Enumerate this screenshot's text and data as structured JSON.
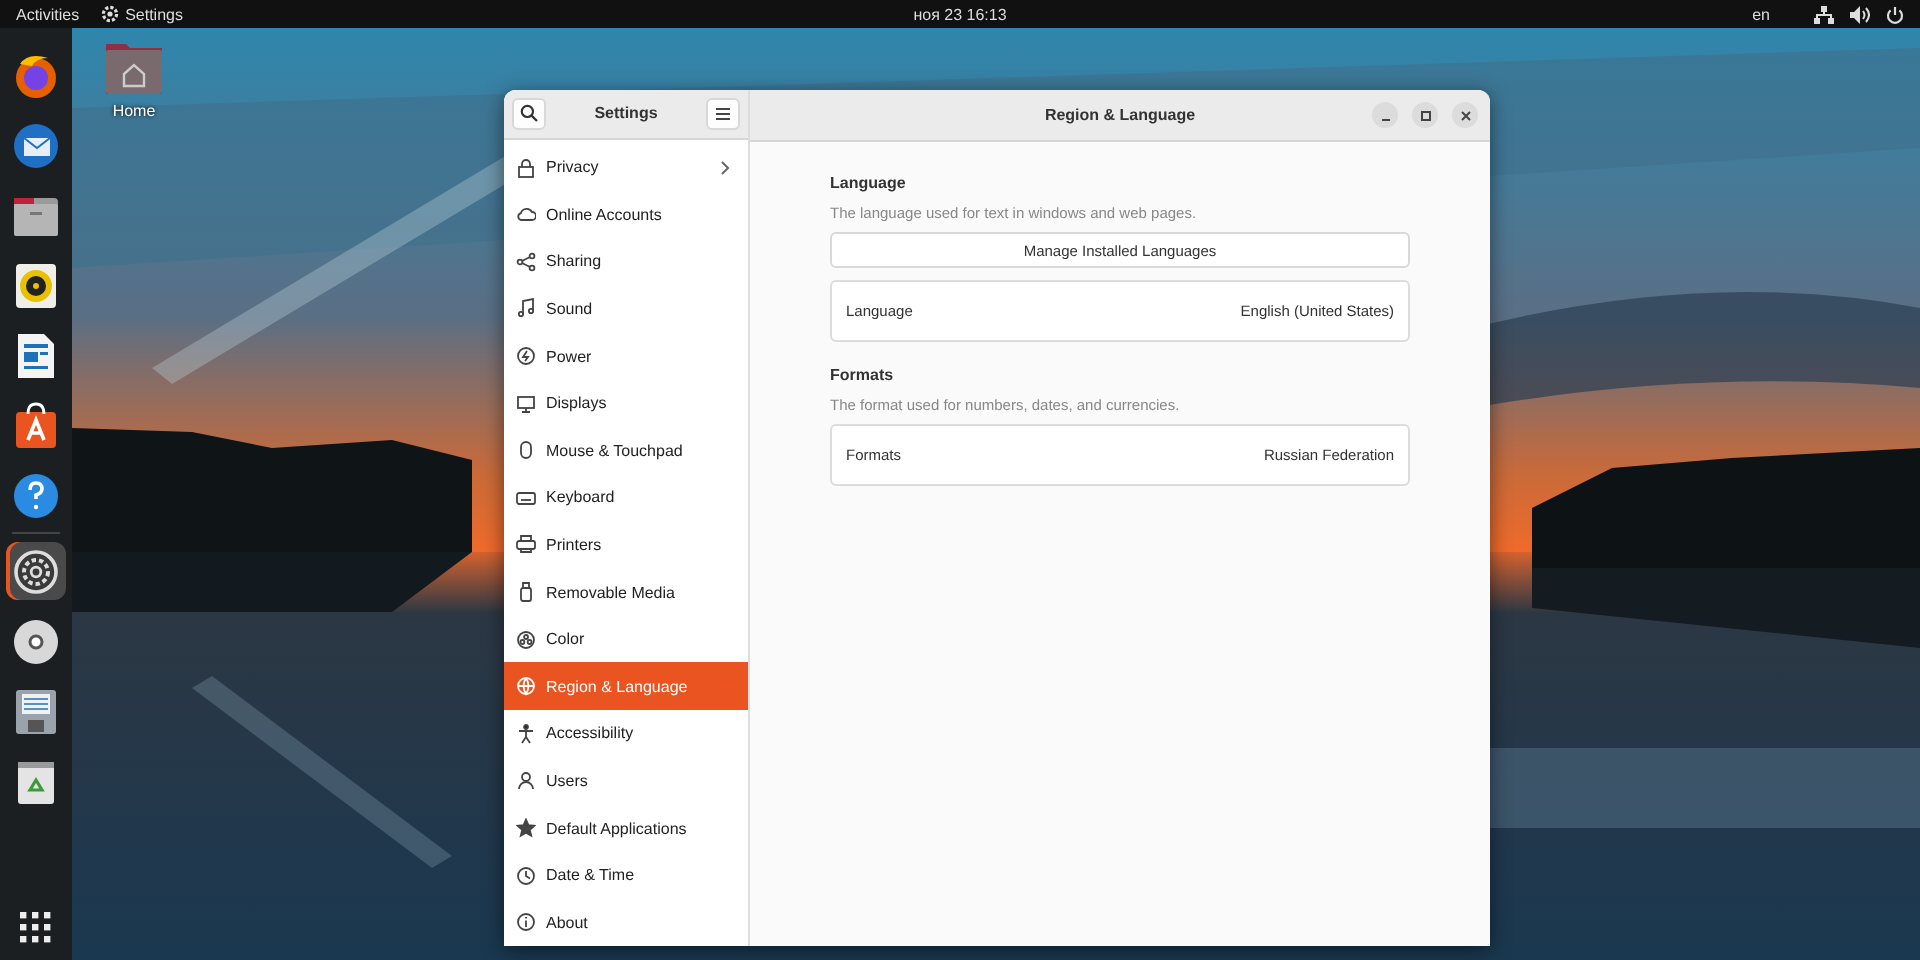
{
  "top_bar": {
    "activities": "Activities",
    "app_menu": "Settings",
    "clock": "ноя 23  16:13",
    "input_source": "en"
  },
  "dock": [
    {
      "selected": false
    },
    {
      "selected": false
    },
    {
      "selected": false
    },
    {
      "selected": false
    },
    {
      "selected": false
    },
    {
      "selected": false
    },
    {
      "selected": false
    },
    {
      "selected": true
    },
    {
      "selected": false
    },
    {
      "selected": false
    },
    {
      "selected": false
    }
  ],
  "desktop_icons": [
    {
      "label": "Home"
    }
  ],
  "window": {
    "sidebar_title": "Settings",
    "title": "Region & Language"
  },
  "sidebar": {
    "items": [
      {
        "label": "Privacy",
        "selected": false,
        "chevron": true
      },
      {
        "label": "Online Accounts",
        "selected": false,
        "chevron": false
      },
      {
        "label": "Sharing",
        "selected": false,
        "chevron": false
      },
      {
        "label": "Sound",
        "selected": false,
        "chevron": false
      },
      {
        "label": "Power",
        "selected": false,
        "chevron": false
      },
      {
        "label": "Displays",
        "selected": false,
        "chevron": false
      },
      {
        "label": "Mouse & Touchpad",
        "selected": false,
        "chevron": false
      },
      {
        "label": "Keyboard",
        "selected": false,
        "chevron": false
      },
      {
        "label": "Printers",
        "selected": false,
        "chevron": false
      },
      {
        "label": "Removable Media",
        "selected": false,
        "chevron": false
      },
      {
        "label": "Color",
        "selected": false,
        "chevron": false
      },
      {
        "label": "Region & Language",
        "selected": true,
        "chevron": false
      },
      {
        "label": "Accessibility",
        "selected": false,
        "chevron": false
      },
      {
        "label": "Users",
        "selected": false,
        "chevron": false
      },
      {
        "label": "Default Applications",
        "selected": false,
        "chevron": false
      },
      {
        "label": "Date & Time",
        "selected": false,
        "chevron": false
      },
      {
        "label": "About",
        "selected": false,
        "chevron": false
      }
    ]
  },
  "sections": [
    {
      "heading": "Language",
      "description": "The language used for text in windows and web pages.",
      "button": "Manage Installed Languages",
      "rows": [
        {
          "label": "Language",
          "value": "English (United States)"
        }
      ]
    },
    {
      "heading": "Formats",
      "description": "The format used for numbers, dates, and currencies.",
      "rows": [
        {
          "label": "Formats",
          "value": "Russian Federation"
        }
      ]
    }
  ]
}
